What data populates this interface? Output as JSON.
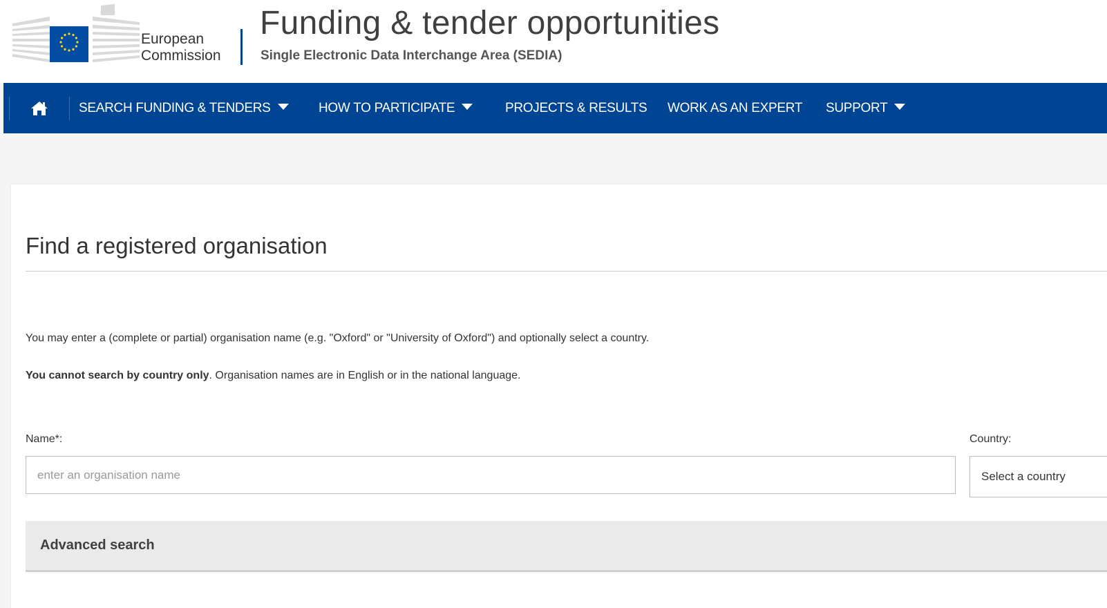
{
  "header": {
    "logo_line1": "European",
    "logo_line2": "Commission",
    "title": "Funding & tender opportunities",
    "subtitle": "Single Electronic Data Interchange Area (SEDIA)"
  },
  "nav": {
    "home_icon": "home-icon",
    "items": [
      {
        "label": "SEARCH FUNDING & TENDERS",
        "has_dropdown": true
      },
      {
        "label": "HOW TO PARTICIPATE",
        "has_dropdown": true
      },
      {
        "label": "PROJECTS & RESULTS",
        "has_dropdown": false
      },
      {
        "label": "WORK AS AN EXPERT",
        "has_dropdown": false
      },
      {
        "label": "SUPPORT",
        "has_dropdown": true
      }
    ]
  },
  "main": {
    "title": "Find a registered organisation",
    "intro": "You may enter a (complete or partial) organisation name (e.g. \"Oxford\" or \"University of Oxford\") and optionally select a country.",
    "note_bold": "You cannot search by country only",
    "note_rest": ". Organisation names are in English or in the national language.",
    "name_label": "Name*:",
    "name_placeholder": "enter an organisation name",
    "name_value": "",
    "country_label": "Country:",
    "country_value": "Select a country",
    "advanced_label": "Advanced search"
  },
  "colors": {
    "nav_bg": "#004494",
    "eu_flag_blue": "#034ea2",
    "eu_star_yellow": "#ffd617"
  }
}
